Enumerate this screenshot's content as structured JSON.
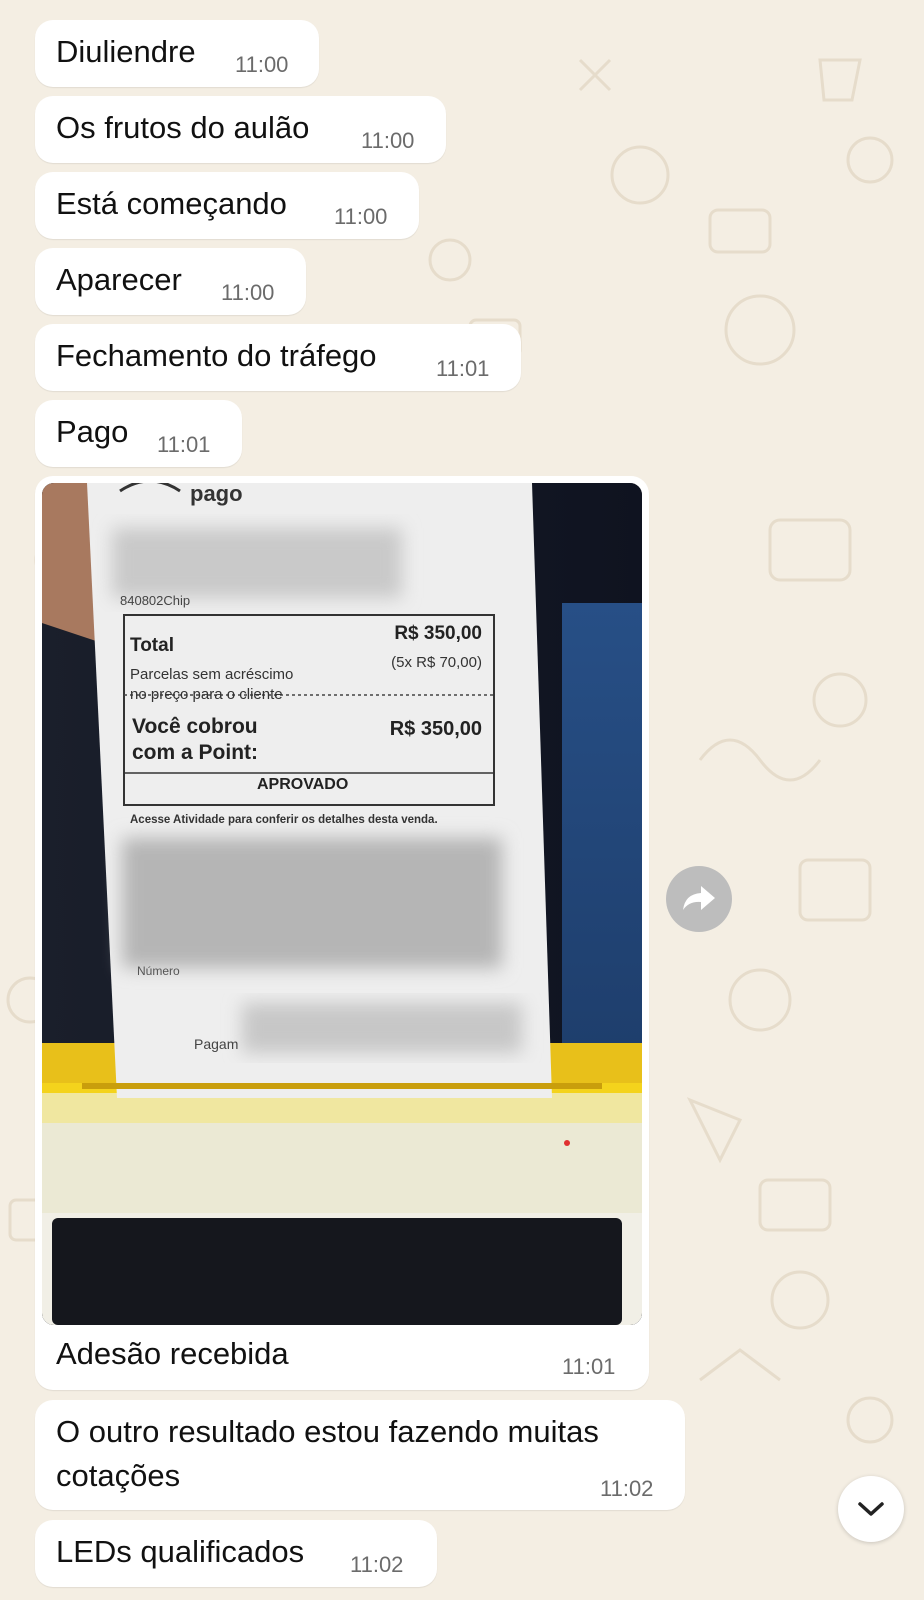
{
  "messages": [
    {
      "text": "Diuliendre",
      "time": "11:00"
    },
    {
      "text": "Os frutos do aulão",
      "time": "11:00"
    },
    {
      "text": "Está começando",
      "time": "11:00"
    },
    {
      "text": "Aparecer",
      "time": "11:00"
    },
    {
      "text": "Fechamento do tráfego",
      "time": "11:01"
    },
    {
      "text": "Pago",
      "time": "11:01"
    }
  ],
  "image_message": {
    "caption": "Adesão recebida",
    "time": "11:01",
    "receipt": {
      "brand": "pago",
      "chip_line": "840802Chip",
      "total_label": "Total",
      "total_value": "R$ 350,00",
      "installments": "(5x R$ 70,00)",
      "parcelas_line1": "Parcelas sem acréscimo",
      "parcelas_line2": "no preço para o cliente",
      "charged_line1": "Você cobrou",
      "charged_line2": "com a Point:",
      "charged_value": "R$ 350,00",
      "status": "APROVADO",
      "footer_note": "Acesse Atividade para conferir os detalhes desta venda.",
      "numero_partial": "Número",
      "pagam_partial": "Pagam"
    }
  },
  "messages_after": [
    {
      "line1": "O outro resultado estou fazendo muitas",
      "line2": "cotações",
      "time": "11:02"
    },
    {
      "text": "LEDs qualificados",
      "time": "11:02"
    }
  ],
  "icons": {
    "forward": "forward-icon",
    "scroll_down": "chevron-down-icon"
  },
  "colors": {
    "wallpaper": "#f4eee3",
    "bubble": "#ffffff",
    "timestamp": "#6b6b6b",
    "printer_yellow": "#f4d31c"
  }
}
